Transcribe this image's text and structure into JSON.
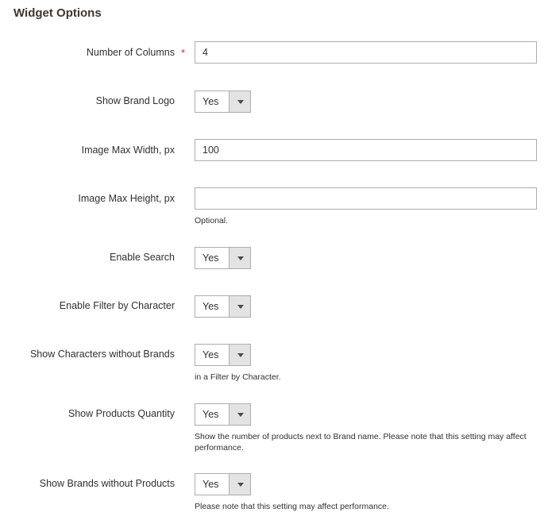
{
  "section": {
    "title": "Widget Options"
  },
  "fields": {
    "columns": {
      "label": "Number of Columns",
      "required_mark": "*",
      "value": "4"
    },
    "logo": {
      "label": "Show Brand Logo",
      "value": "Yes"
    },
    "width": {
      "label": "Image Max Width, px",
      "value": "100"
    },
    "height": {
      "label": "Image Max Height, px",
      "value": "",
      "note": "Optional."
    },
    "search": {
      "label": "Enable Search",
      "value": "Yes"
    },
    "filter": {
      "label": "Enable Filter by Character",
      "value": "Yes"
    },
    "chars": {
      "label": "Show Characters without Brands",
      "value": "Yes",
      "note": "in a Filter by Character."
    },
    "qty": {
      "label": "Show Products Quantity",
      "value": "Yes",
      "note": "Show the number of products next to Brand name. Please note that this setting may affect performance."
    },
    "noprod": {
      "label": "Show Brands without Products",
      "value": "Yes",
      "note": "Please note that this setting may affect performance."
    }
  },
  "colors": {
    "required": "#e22626",
    "border": "#adadad",
    "arrow_bg": "#e3e3e3"
  }
}
